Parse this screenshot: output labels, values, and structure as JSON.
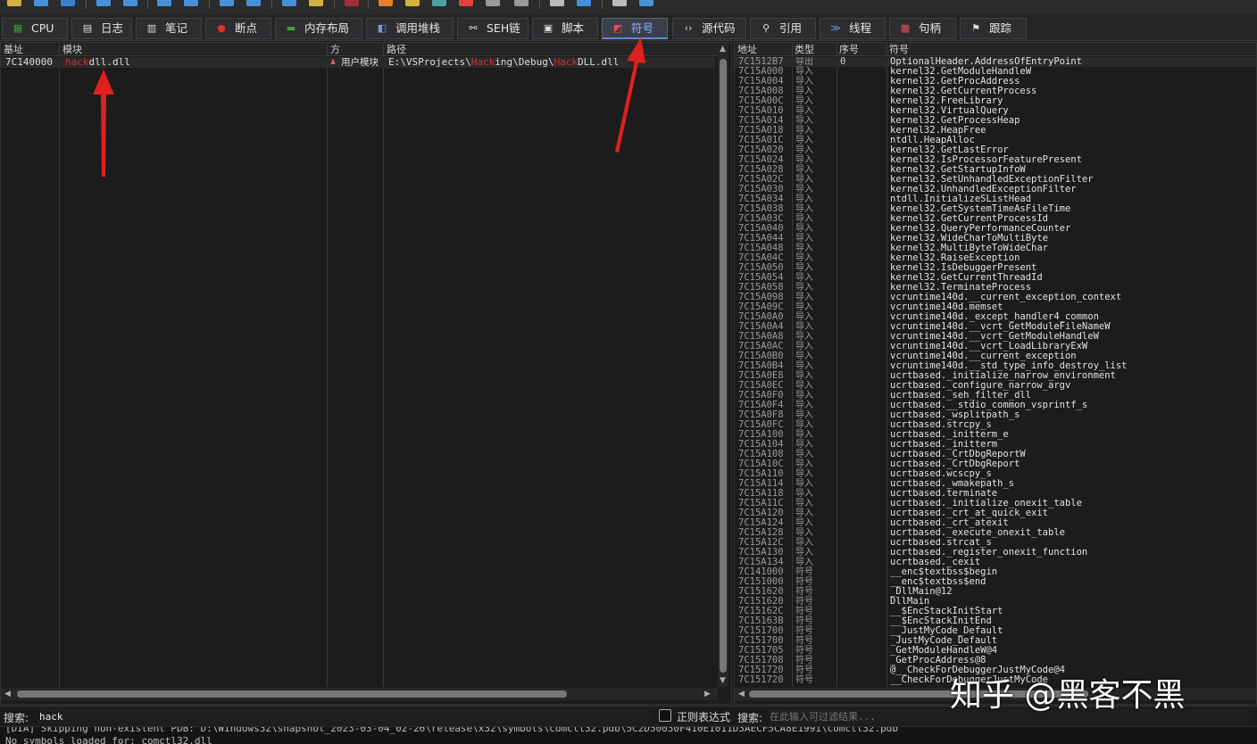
{
  "tabs": [
    {
      "label": "CPU",
      "icon": "cpu-icon",
      "glyph": "▦",
      "color": "#3a9d3a"
    },
    {
      "label": "日志",
      "icon": "log-icon",
      "glyph": "▤",
      "color": "#dddddd"
    },
    {
      "label": "笔记",
      "icon": "notes-icon",
      "glyph": "▥",
      "color": "#dddddd"
    },
    {
      "label": "断点",
      "icon": "breakpoint-icon",
      "glyph": "●",
      "color": "#e03030"
    },
    {
      "label": "内存布局",
      "icon": "memory-map-icon",
      "glyph": "▬",
      "color": "#3aa03a"
    },
    {
      "label": "调用堆栈",
      "icon": "call-stack-icon",
      "glyph": "◧",
      "color": "#6aa0e0"
    },
    {
      "label": "SEH链",
      "icon": "seh-chain-icon",
      "glyph": "⚯",
      "color": "#dddddd"
    },
    {
      "label": "脚本",
      "icon": "script-icon",
      "glyph": "▣",
      "color": "#dddddd"
    },
    {
      "label": "符号",
      "icon": "symbols-icon",
      "glyph": "◩",
      "color": "#e05050",
      "active": true
    },
    {
      "label": "源代码",
      "icon": "source-code-icon",
      "glyph": "‹›",
      "color": "#dddddd"
    },
    {
      "label": "引用",
      "icon": "references-icon",
      "glyph": "⚲",
      "color": "#dddddd"
    },
    {
      "label": "线程",
      "icon": "threads-icon",
      "glyph": "≫",
      "color": "#5a9ae0"
    },
    {
      "label": "句柄",
      "icon": "handles-icon",
      "glyph": "▩",
      "color": "#e05050"
    },
    {
      "label": "跟踪",
      "icon": "trace-icon",
      "glyph": "⚑",
      "color": "#dddddd"
    }
  ],
  "modules": {
    "headers": {
      "base": "基址",
      "module": "模块",
      "party": "方",
      "path": "路径"
    },
    "rows": [
      {
        "base": "7C140000",
        "module_parts": [
          {
            "t": "hack",
            "hl": true
          },
          {
            "t": "dll.dll",
            "hl": false
          }
        ],
        "party": "用户模块",
        "path_parts": [
          {
            "t": "E:\\VSProjects\\",
            "hl": false
          },
          {
            "t": "Hack",
            "hl": true
          },
          {
            "t": "ing\\Debug\\",
            "hl": false
          },
          {
            "t": "Hack",
            "hl": true
          },
          {
            "t": "DLL.dll",
            "hl": false
          }
        ]
      }
    ]
  },
  "symbols": {
    "headers": {
      "address": "地址",
      "type": "类型",
      "ordinal": "序号",
      "symbol": "符号"
    },
    "rows": [
      [
        "7C1512B7",
        "导出",
        "0",
        "OptionalHeader.AddressOfEntryPoint"
      ],
      [
        "7C15A000",
        "导入",
        "",
        "kernel32.GetModuleHandleW"
      ],
      [
        "7C15A004",
        "导入",
        "",
        "kernel32.GetProcAddress"
      ],
      [
        "7C15A008",
        "导入",
        "",
        "kernel32.GetCurrentProcess"
      ],
      [
        "7C15A00C",
        "导入",
        "",
        "kernel32.FreeLibrary"
      ],
      [
        "7C15A010",
        "导入",
        "",
        "kernel32.VirtualQuery"
      ],
      [
        "7C15A014",
        "导入",
        "",
        "kernel32.GetProcessHeap"
      ],
      [
        "7C15A018",
        "导入",
        "",
        "kernel32.HeapFree"
      ],
      [
        "7C15A01C",
        "导入",
        "",
        "ntdll.HeapAlloc"
      ],
      [
        "7C15A020",
        "导入",
        "",
        "kernel32.GetLastError"
      ],
      [
        "7C15A024",
        "导入",
        "",
        "kernel32.IsProcessorFeaturePresent"
      ],
      [
        "7C15A028",
        "导入",
        "",
        "kernel32.GetStartupInfoW"
      ],
      [
        "7C15A02C",
        "导入",
        "",
        "kernel32.SetUnhandledExceptionFilter"
      ],
      [
        "7C15A030",
        "导入",
        "",
        "kernel32.UnhandledExceptionFilter"
      ],
      [
        "7C15A034",
        "导入",
        "",
        "ntdll.InitializeSListHead"
      ],
      [
        "7C15A038",
        "导入",
        "",
        "kernel32.GetSystemTimeAsFileTime"
      ],
      [
        "7C15A03C",
        "导入",
        "",
        "kernel32.GetCurrentProcessId"
      ],
      [
        "7C15A040",
        "导入",
        "",
        "kernel32.QueryPerformanceCounter"
      ],
      [
        "7C15A044",
        "导入",
        "",
        "kernel32.WideCharToMultiByte"
      ],
      [
        "7C15A048",
        "导入",
        "",
        "kernel32.MultiByteToWideChar"
      ],
      [
        "7C15A04C",
        "导入",
        "",
        "kernel32.RaiseException"
      ],
      [
        "7C15A050",
        "导入",
        "",
        "kernel32.IsDebuggerPresent"
      ],
      [
        "7C15A054",
        "导入",
        "",
        "kernel32.GetCurrentThreadId"
      ],
      [
        "7C15A058",
        "导入",
        "",
        "kernel32.TerminateProcess"
      ],
      [
        "7C15A098",
        "导入",
        "",
        "vcruntime140d.__current_exception_context"
      ],
      [
        "7C15A09C",
        "导入",
        "",
        "vcruntime140d.memset"
      ],
      [
        "7C15A0A0",
        "导入",
        "",
        "vcruntime140d._except_handler4_common"
      ],
      [
        "7C15A0A4",
        "导入",
        "",
        "vcruntime140d.__vcrt_GetModuleFileNameW"
      ],
      [
        "7C15A0A8",
        "导入",
        "",
        "vcruntime140d.__vcrt_GetModuleHandleW"
      ],
      [
        "7C15A0AC",
        "导入",
        "",
        "vcruntime140d.__vcrt_LoadLibraryExW"
      ],
      [
        "7C15A0B0",
        "导入",
        "",
        "vcruntime140d.__current_exception"
      ],
      [
        "7C15A0B4",
        "导入",
        "",
        "vcruntime140d.__std_type_info_destroy_list"
      ],
      [
        "7C15A0E8",
        "导入",
        "",
        "ucrtbased._initialize_narrow_environment"
      ],
      [
        "7C15A0EC",
        "导入",
        "",
        "ucrtbased._configure_narrow_argv"
      ],
      [
        "7C15A0F0",
        "导入",
        "",
        "ucrtbased._seh_filter_dll"
      ],
      [
        "7C15A0F4",
        "导入",
        "",
        "ucrtbased.__stdio_common_vsprintf_s"
      ],
      [
        "7C15A0F8",
        "导入",
        "",
        "ucrtbased._wsplitpath_s"
      ],
      [
        "7C15A0FC",
        "导入",
        "",
        "ucrtbased.strcpy_s"
      ],
      [
        "7C15A100",
        "导入",
        "",
        "ucrtbased._initterm_e"
      ],
      [
        "7C15A104",
        "导入",
        "",
        "ucrtbased._initterm"
      ],
      [
        "7C15A108",
        "导入",
        "",
        "ucrtbased._CrtDbgReportW"
      ],
      [
        "7C15A10C",
        "导入",
        "",
        "ucrtbased._CrtDbgReport"
      ],
      [
        "7C15A110",
        "导入",
        "",
        "ucrtbased.wcscpy_s"
      ],
      [
        "7C15A114",
        "导入",
        "",
        "ucrtbased._wmakepath_s"
      ],
      [
        "7C15A118",
        "导入",
        "",
        "ucrtbased.terminate"
      ],
      [
        "7C15A11C",
        "导入",
        "",
        "ucrtbased._initialize_onexit_table"
      ],
      [
        "7C15A120",
        "导入",
        "",
        "ucrtbased._crt_at_quick_exit"
      ],
      [
        "7C15A124",
        "导入",
        "",
        "ucrtbased._crt_atexit"
      ],
      [
        "7C15A128",
        "导入",
        "",
        "ucrtbased._execute_onexit_table"
      ],
      [
        "7C15A12C",
        "导入",
        "",
        "ucrtbased.strcat_s"
      ],
      [
        "7C15A130",
        "导入",
        "",
        "ucrtbased._register_onexit_function"
      ],
      [
        "7C15A134",
        "导入",
        "",
        "ucrtbased._cexit"
      ],
      [
        "7C141000",
        "符号",
        "",
        "__enc$textbss$begin"
      ],
      [
        "7C151000",
        "符号",
        "",
        "__enc$textbss$end"
      ],
      [
        "7C151620",
        "符号",
        "",
        "_DllMain@12"
      ],
      [
        "7C151620",
        "符号",
        "",
        "DllMain"
      ],
      [
        "7C15162C",
        "符号",
        "",
        "__$EncStackInitStart"
      ],
      [
        "7C15163B",
        "符号",
        "",
        "__$EncStackInitEnd"
      ],
      [
        "7C151700",
        "符号",
        "",
        "__JustMyCode_Default"
      ],
      [
        "7C151700",
        "符号",
        "",
        "_JustMyCode_Default"
      ],
      [
        "7C151705",
        "符号",
        "",
        "_GetModuleHandleW@4"
      ],
      [
        "7C151708",
        "符号",
        "",
        "_GetProcAddress@8"
      ],
      [
        "7C151720",
        "符号",
        "",
        "@__CheckForDebuggerJustMyCode@4"
      ],
      [
        "7C151720",
        "符号",
        "",
        "__CheckForDebuggerJustMyCode"
      ]
    ]
  },
  "left_search": {
    "label": "搜索:",
    "value": "hack",
    "regex_label": "正则表达式"
  },
  "right_search": {
    "label": "搜索:",
    "placeholder": "在此输入可过滤结果..."
  },
  "log": {
    "line1": "[DIA] Skipping non-existent PDB: D:\\Windows32\\snapshot_2023-03-04_02-26\\release\\x32\\symbols\\comctl32.pdb\\5C2D50030F410E1011D3AECF5CA8E1991\\comctl32.pdb",
    "line2": "No symbols loaded for: comctl32.dll"
  },
  "watermark": "知乎 @黑客不黑",
  "colors": {
    "highlight": "#d03030",
    "active_tab": "#8fb3ff",
    "arrow": "#e02020"
  }
}
